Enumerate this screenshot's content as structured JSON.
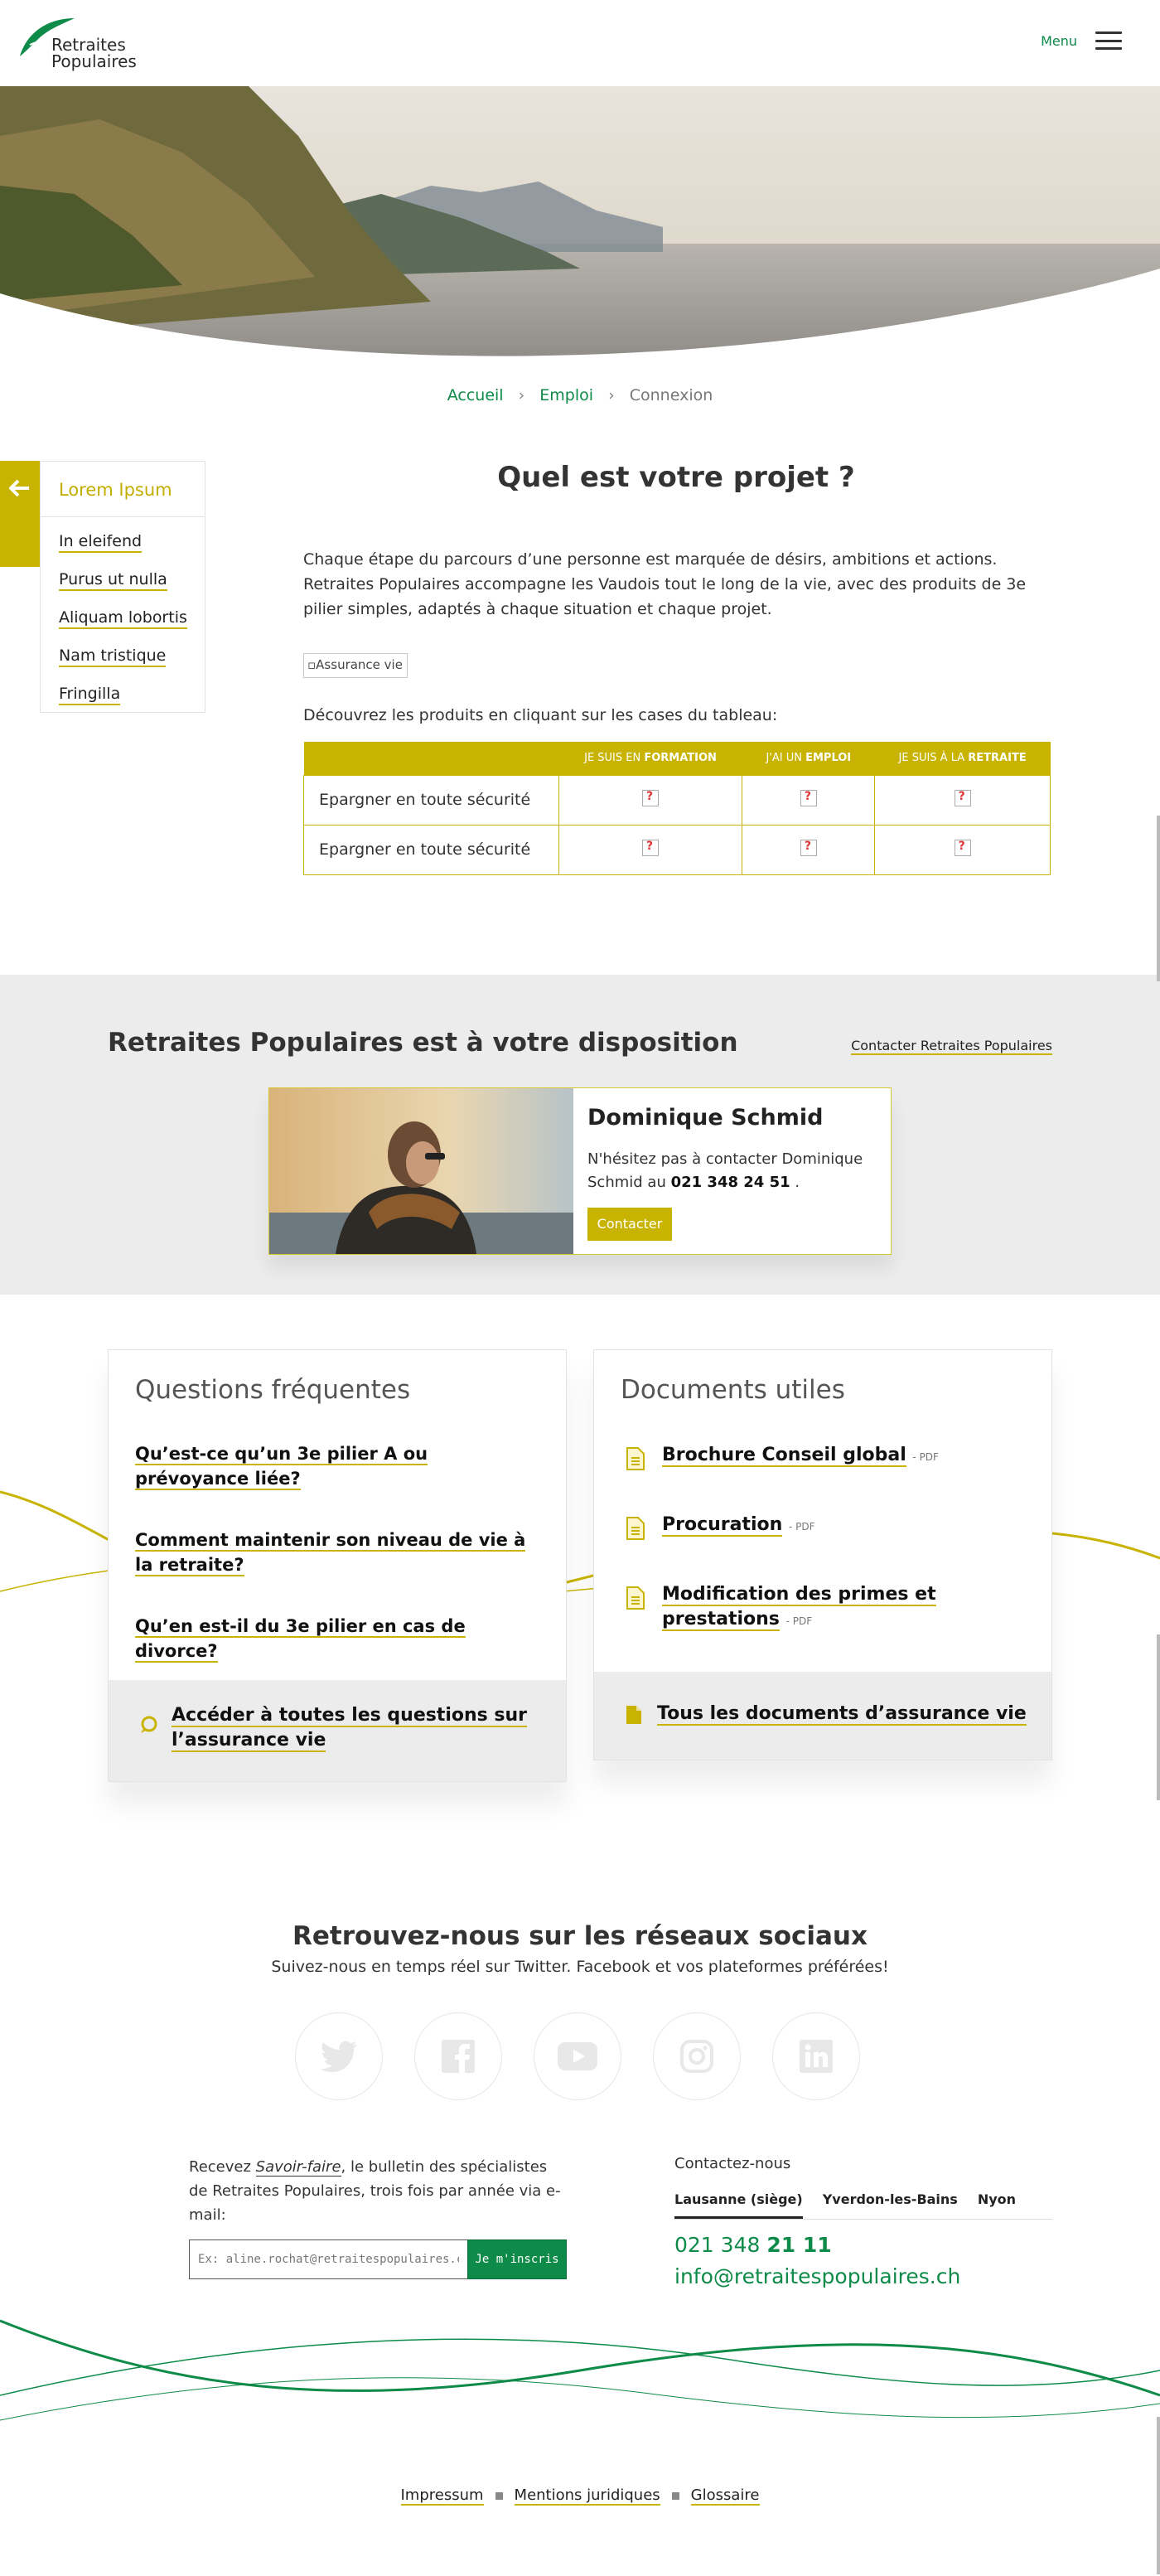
{
  "header": {
    "logo_line1": "Retraites",
    "logo_line2": "Populaires",
    "menu_label": "Menu"
  },
  "breadcrumb": {
    "items": [
      "Accueil",
      "Emploi",
      "Connexion"
    ],
    "separator": "›"
  },
  "sidebar": {
    "title": "Lorem Ipsum",
    "items": [
      "In eleifend",
      "Purus ut nulla",
      "Aliquam lobortis",
      "Nam tristique",
      "Fringilla"
    ]
  },
  "main": {
    "title": "Quel est votre projet ?",
    "intro": "Chaque étape du parcours d’une personne est marquée de désirs, ambitions et actions. Retraites Populaires accompagne les Vaudois tout le long de la vie, avec des produits de 3e pilier simples, adaptés à chaque situation et chaque projet.",
    "image_alt": "Assurance vie",
    "table_intro": "Découvrez les produits en cliquant sur les cases du tableau:",
    "table": {
      "columns": [
        {
          "pre": "Je suis en ",
          "strong": "formation"
        },
        {
          "pre": "J'ai un ",
          "strong": "emploi"
        },
        {
          "pre": "Je suis à la ",
          "strong": "retraite"
        }
      ],
      "rows": [
        "Epargner en toute sécurité",
        "Epargner en toute sécurité"
      ]
    }
  },
  "contact_band": {
    "title": "Retraites Populaires est à votre disposition",
    "link": "Contacter Retraites Populaires",
    "person_name": "Dominique Schmid",
    "text_before": "N'hésitez pas à contacter Dominique Schmid au ",
    "phone": "021 348 24 51",
    "text_after": " .",
    "button": "Contacter"
  },
  "faq": {
    "title": "Questions fréquentes",
    "items": [
      "Qu’est-ce qu’un 3e pilier A ou prévoyance liée?",
      "Comment maintenir son niveau de vie à la retraite?",
      "Qu’en est-il du 3e pilier en cas de divorce?"
    ],
    "footer_link": "Accéder à toutes les questions sur l’assurance vie"
  },
  "docs": {
    "title": "Documents utiles",
    "items": [
      {
        "label": "Brochure Conseil global",
        "suffix": "- PDF"
      },
      {
        "label": "Procuration",
        "suffix": "- PDF"
      },
      {
        "label": "Modification des primes et prestations",
        "suffix": "- PDF"
      }
    ],
    "footer_link": "Tous les documents d’assurance vie"
  },
  "social": {
    "title": "Retrouvez-nous sur les réseaux sociaux",
    "subtitle": "Suivez-nous en temps réel sur Twitter. Facebook et vos plateformes préférées!",
    "networks": [
      "twitter-icon",
      "facebook-icon",
      "youtube-icon",
      "instagram-icon",
      "linkedin-icon"
    ]
  },
  "newsletter": {
    "text_before": "Recevez ",
    "text_em": "Savoir-faire",
    "text_after": ", le bulletin des spécialistes de Retraites Populaires, trois fois par année via e-mail:",
    "placeholder": "Ex: aline.rochat@retraitespopulaires.ch",
    "button": "Je m'inscris"
  },
  "contact": {
    "title": "Contactez-nous",
    "tabs": [
      "Lausanne (siège)",
      "Yverdon-les-Bains",
      "Nyon"
    ],
    "active_tab": "Lausanne (siège)",
    "phone_prefix": "021 348 ",
    "phone_strong": "21 11",
    "email": "info@retraitespopulaires.ch"
  },
  "footer": {
    "links": [
      "Impressum",
      "Mentions juridiques",
      "Glossaire"
    ]
  },
  "colors": {
    "brand_green": "#0e8a49",
    "accent_yellow": "#c8b400",
    "band_grey": "#ececec"
  }
}
